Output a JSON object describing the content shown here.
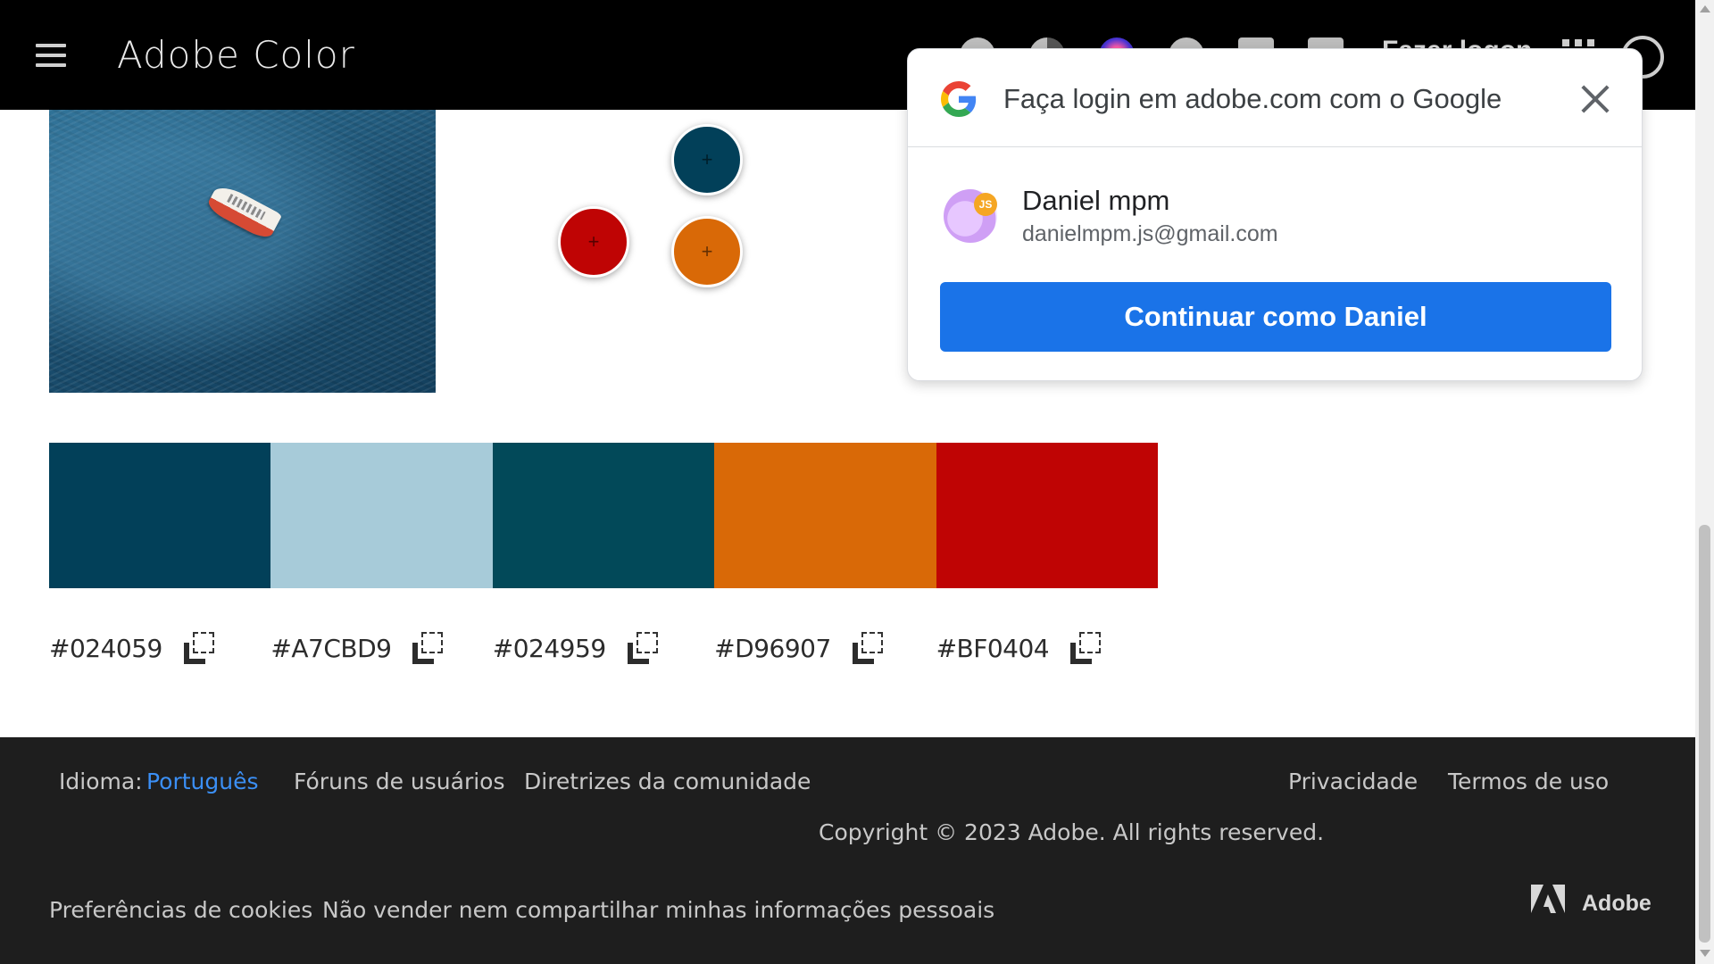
{
  "header": {
    "app_title": "Adobe Color",
    "login_label": "Fazer logon",
    "icons": [
      "accessibility-icon",
      "contrast-icon",
      "ai-sparkle-icon",
      "help-icon",
      "info-icon",
      "chat-icon"
    ]
  },
  "palette": {
    "handles": [
      {
        "name": "handle-top",
        "color": "#024059",
        "glyph": "+"
      },
      {
        "name": "handle-left",
        "color": "#BF0404",
        "glyph": "+"
      },
      {
        "name": "handle-right",
        "color": "#D96907",
        "glyph": "+"
      }
    ],
    "swatches": [
      {
        "hex": "#024059",
        "color": "#024059"
      },
      {
        "hex": "#A7CBD9",
        "color": "#A7CBD9"
      },
      {
        "hex": "#024959",
        "color": "#024959"
      },
      {
        "hex": "#D96907",
        "color": "#D96907"
      },
      {
        "hex": "#BF0404",
        "color": "#BF0404"
      }
    ]
  },
  "footer": {
    "language_label": "Idioma:",
    "language_value": "Português",
    "forums": "Fóruns de usuários",
    "guidelines": "Diretrizes da comunidade",
    "privacy": "Privacidade",
    "terms": "Termos de uso",
    "copyright": "Copyright © 2023 Adobe. All rights reserved.",
    "cookies": "Preferências de cookies",
    "do_not_sell": "Não vender nem compartilhar minhas informações pessoais",
    "brand": "Adobe"
  },
  "google_dialog": {
    "title": "Faça login em adobe.com com o Google",
    "account_name": "Daniel mpm",
    "account_email": "danielmpm.js@gmail.com",
    "avatar_badge": "JS",
    "continue_label": "Continuar como Daniel"
  }
}
